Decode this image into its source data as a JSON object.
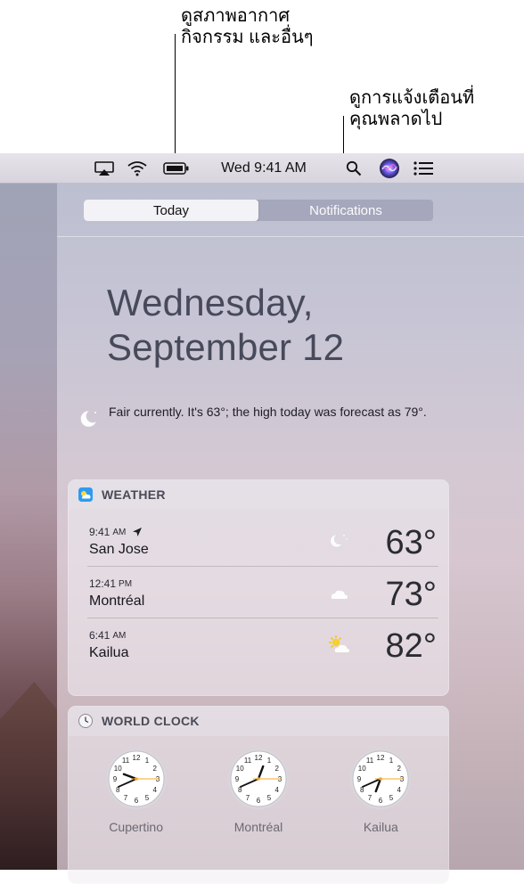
{
  "callouts": {
    "top": [
      "ดูสภาพอากาศ",
      "กิจกรรม และอื่นๆ"
    ],
    "right": [
      "ดูการแจ้งเตือนที่",
      "คุณพลาดไป"
    ]
  },
  "menubar": {
    "time": "Wed 9:41 AM",
    "icons": [
      "airplay-icon",
      "wifi-icon",
      "battery-icon",
      "search-icon",
      "siri-icon",
      "notification-center-icon"
    ]
  },
  "panel": {
    "tabs": [
      {
        "label": "Today",
        "active": true
      },
      {
        "label": "Notifications",
        "active": false
      }
    ],
    "date_line1": "Wednesday,",
    "date_line2": "September 12",
    "summary": "Fair currently. It's 63°; the high today was forecast as 79°."
  },
  "weather": {
    "title": "WEATHER",
    "rows": [
      {
        "time": "9:41",
        "ampm": "AM",
        "city": "San Jose",
        "temp": "63°",
        "condition": "moon-clear-icon",
        "current_location": true
      },
      {
        "time": "12:41",
        "ampm": "PM",
        "city": "Montréal",
        "temp": "73°",
        "condition": "cloud-icon",
        "current_location": false
      },
      {
        "time": "6:41",
        "ampm": "AM",
        "city": "Kailua",
        "temp": "82°",
        "condition": "partly-sunny-icon",
        "current_location": false
      }
    ]
  },
  "world_clock": {
    "title": "WORLD CLOCK",
    "clocks": [
      {
        "city": "Cupertino",
        "hour": 9,
        "minute": 41,
        "second": 15
      },
      {
        "city": "Montréal",
        "hour": 12,
        "minute": 41,
        "second": 15
      },
      {
        "city": "Kailua",
        "hour": 6,
        "minute": 41,
        "second": 15
      }
    ]
  },
  "colors": {
    "accent_second_hand": "#f5a623",
    "weather_icon": "#2b9cf0"
  }
}
